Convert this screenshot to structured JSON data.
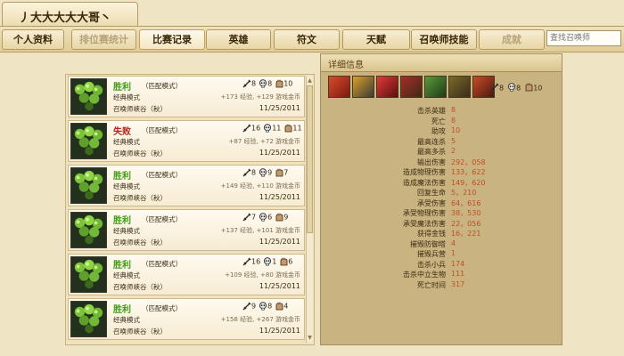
{
  "summoner": {
    "name": "丿大大大大大哥丶"
  },
  "nav": {
    "tabs": [
      {
        "label": "个人资料",
        "state": "normal"
      },
      {
        "label": "排位赛统计",
        "state": "disabled"
      },
      {
        "label": "比赛记录",
        "state": "active"
      },
      {
        "label": "英雄",
        "state": "normal"
      },
      {
        "label": "符文",
        "state": "normal"
      },
      {
        "label": "天赋",
        "state": "normal"
      },
      {
        "label": "召唤师技能",
        "state": "normal"
      },
      {
        "label": "成就",
        "state": "disabled"
      }
    ],
    "search_placeholder": "查找召唤师"
  },
  "matches": [
    {
      "result": "胜利",
      "win": true,
      "queue": "（匹配模式）",
      "mode": "经典模式",
      "map": "召唤师峡谷（秋）",
      "kills": 8,
      "deaths": 8,
      "assists": 10,
      "reward": "+173 经验, +129 游戏金币",
      "date": "11/25/2011"
    },
    {
      "result": "失败",
      "win": false,
      "queue": "（匹配模式）",
      "mode": "经典模式",
      "map": "召唤师峡谷（秋）",
      "kills": 16,
      "deaths": 11,
      "assists": 11,
      "reward": "+87 经验, +72 游戏金币",
      "date": "11/25/2011"
    },
    {
      "result": "胜利",
      "win": true,
      "queue": "（匹配模式）",
      "mode": "经典模式",
      "map": "召唤师峡谷（秋）",
      "kills": 8,
      "deaths": 9,
      "assists": 7,
      "reward": "+149 经验, +110 游戏金币",
      "date": "11/25/2011"
    },
    {
      "result": "胜利",
      "win": true,
      "queue": "（匹配模式）",
      "mode": "经典模式",
      "map": "召唤师峡谷（秋）",
      "kills": 7,
      "deaths": 6,
      "assists": 9,
      "reward": "+137 经验, +101 游戏金币",
      "date": "11/25/2011"
    },
    {
      "result": "胜利",
      "win": true,
      "queue": "（匹配模式）",
      "mode": "经典模式",
      "map": "召唤师峡谷（秋）",
      "kills": 16,
      "deaths": 1,
      "assists": 6,
      "reward": "+109 经验, +80 游戏金币",
      "date": "11/25/2011"
    },
    {
      "result": "胜利",
      "win": true,
      "queue": "（匹配模式）",
      "mode": "经典模式",
      "map": "召唤师峡谷（秋）",
      "kills": 9,
      "deaths": 8,
      "assists": 4,
      "reward": "+158 经验, +267 游戏金币",
      "date": "11/25/2011"
    }
  ],
  "detail": {
    "title": "详细信息",
    "kills": 8,
    "deaths": 8,
    "assists": 10,
    "items": [
      "item-1",
      "item-2",
      "item-3",
      "item-4",
      "item-5",
      "item-6",
      "item-7"
    ],
    "stats": [
      {
        "label": "击杀英雄",
        "value": "8"
      },
      {
        "label": "死亡",
        "value": "8"
      },
      {
        "label": "助攻",
        "value": "10"
      },
      {
        "label": "最高连杀",
        "value": "5"
      },
      {
        "label": "最高多杀",
        "value": "2"
      },
      {
        "label": "输出伤害",
        "value": "292，058"
      },
      {
        "label": "造成物理伤害",
        "value": "133，622"
      },
      {
        "label": "造成魔法伤害",
        "value": "149，620"
      },
      {
        "label": "回复生命",
        "value": "5，210"
      },
      {
        "label": "承受伤害",
        "value": "64，616"
      },
      {
        "label": "承受物理伤害",
        "value": "38，530"
      },
      {
        "label": "承受魔法伤害",
        "value": "22，056"
      },
      {
        "label": "获得金钱",
        "value": "16，221"
      },
      {
        "label": "摧毁防御塔",
        "value": "4"
      },
      {
        "label": "摧毁兵营",
        "value": "1"
      },
      {
        "label": "击杀小兵",
        "value": "174"
      },
      {
        "label": "击杀中立生物",
        "value": "111"
      },
      {
        "label": "死亡时间",
        "value": "317"
      }
    ]
  },
  "colors": {
    "win": "#3e9d12",
    "loss": "#b0271d",
    "stat_value": "#c44d23"
  }
}
